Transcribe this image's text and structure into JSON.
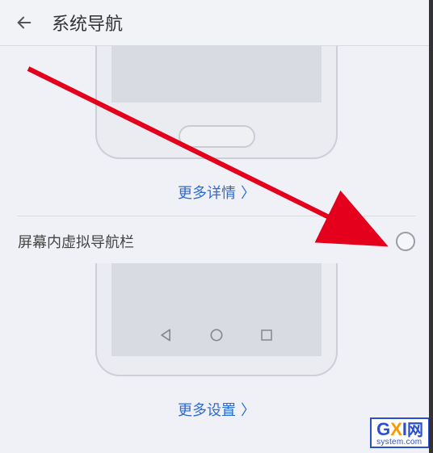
{
  "header": {
    "title": "系统导航"
  },
  "section1": {
    "more_link": "更多详情",
    "chevron": "〉"
  },
  "row": {
    "label": "屏幕内虚拟导航栏"
  },
  "section2": {
    "more_link": "更多设置",
    "chevron": "〉"
  },
  "watermark": {
    "g": "G",
    "x": "X",
    "i": "I",
    "cn": "网",
    "url": "system.com"
  }
}
